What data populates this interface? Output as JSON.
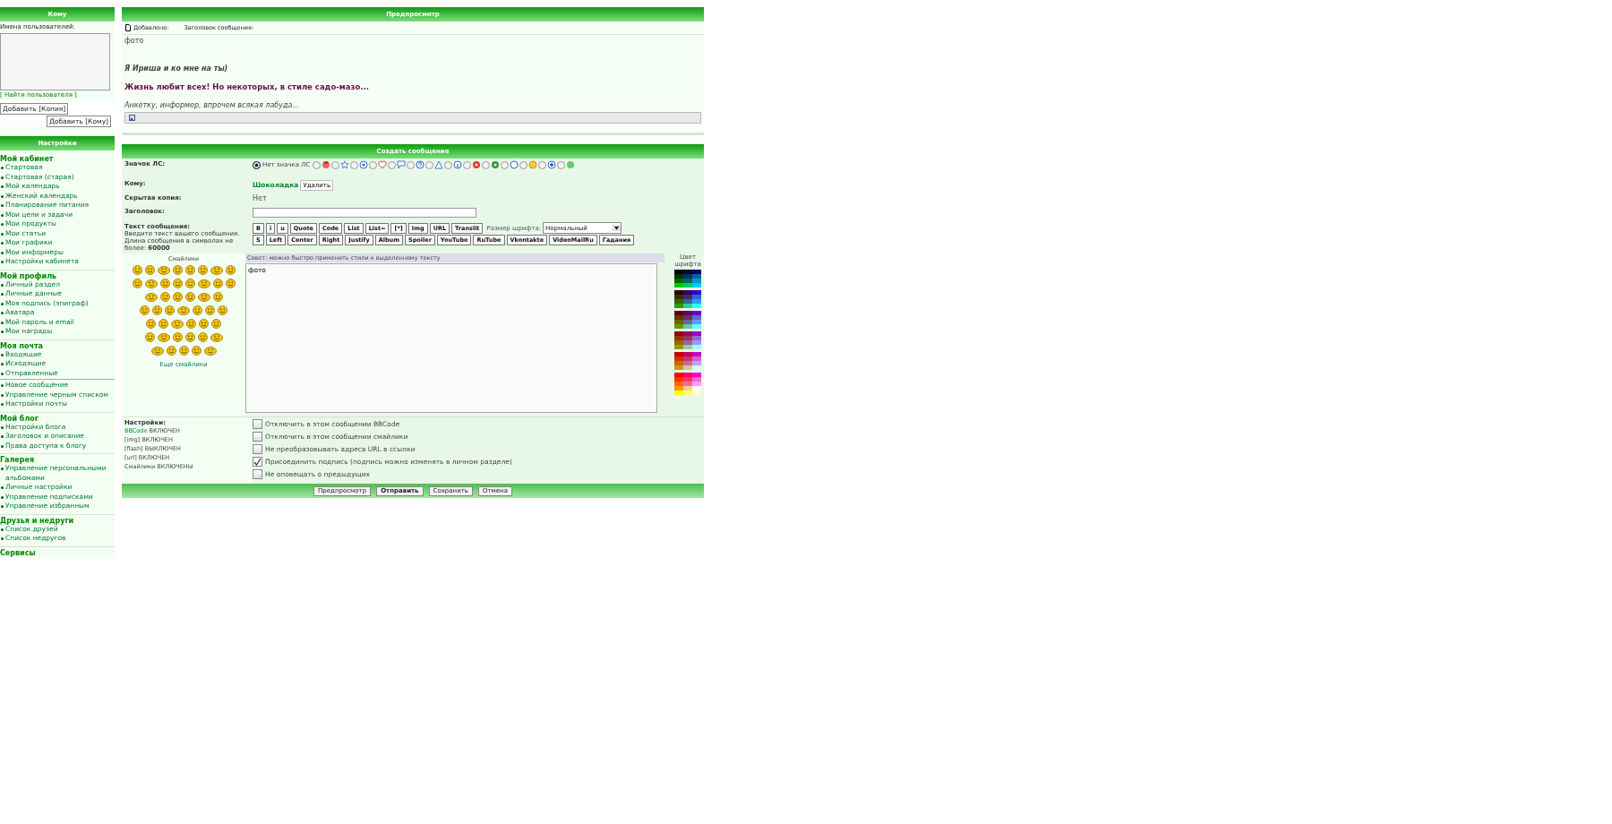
{
  "to_panel": {
    "title": "Кому",
    "label": "Имена пользователей:",
    "find_link": "[ Найти пользователя ]",
    "buttons": [
      "Добавить [Копия]",
      "Добавить [Кому]"
    ]
  },
  "settings_panel": {
    "title": "Настройки",
    "groups": [
      {
        "title": "Мой кабинет",
        "items": [
          "Стартовая",
          "Стартовая (старая)",
          "Мой календарь",
          "Женский календарь",
          "Планирование питания",
          "Мои цели и задачи",
          "Мои продукты",
          "Мои статьи",
          "Мои графики",
          "Мои информеры",
          "Настройки кабинета"
        ]
      },
      {
        "title": "Мой профиль",
        "items": [
          "Личный раздел",
          "Личные данные",
          "Моя подпись (эпиграф)",
          "Аватара",
          "Мой пароль и email",
          "Мои награды"
        ]
      },
      {
        "title": "Моя почта",
        "items": [
          "Входящие",
          "Исходящие",
          "Отправленные"
        ],
        "extra_items": [
          "Новое сообщение",
          "Управление черным списком",
          "Настройки почты"
        ]
      },
      {
        "title": "Мой блог",
        "items": [
          "Настройки блога",
          "Заголовок и описание",
          "Права доступа к блогу"
        ]
      },
      {
        "title": "Галерея",
        "items": [
          "Управление персональными альбомами",
          "Личные настройки",
          "Управление подписками",
          "Управление избранным"
        ]
      },
      {
        "title": "Друзья и недруги",
        "items": [
          "Список друзей",
          "Список недругов"
        ]
      },
      {
        "title": "Сервисы"
      }
    ]
  },
  "preview": {
    "title": "Предпросмотр",
    "added_label": "Добавлено:",
    "subject_label": "Заголовок сообщения:",
    "body": "фото",
    "signature": [
      {
        "kind": "italic",
        "text": "Я Ириша и ко мне на ты)"
      },
      {
        "kind": "accent",
        "text": "Жизнь любит всех! Но некоторых, в стиле садо-мазо..."
      },
      {
        "kind": "plain",
        "text": "Анкетку, информер, впрочем всякая лабуда..."
      }
    ]
  },
  "compose": {
    "title": "Создать сообщение",
    "icon_label": "Значок ЛС:",
    "icons": [
      {
        "label": "Нет значка ЛС",
        "selected": true
      },
      {
        "selected": false
      },
      {
        "selected": false
      },
      {
        "selected": false
      },
      {
        "selected": false
      },
      {
        "selected": false
      },
      {
        "selected": false
      },
      {
        "selected": false
      },
      {
        "selected": false
      },
      {
        "selected": false
      },
      {
        "selected": false
      },
      {
        "selected": false
      },
      {
        "selected": false
      },
      {
        "selected": false
      },
      {
        "selected": false
      }
    ],
    "to_label": "Кому:",
    "to_user": "Шоколадка",
    "remove_button": "Удалить",
    "bcc_label": "Скрытая копия:",
    "bcc_value": "Нет",
    "subject_label": "Заголовок:",
    "text_label": "Текст сообщения:",
    "text_hint": "Введите текст вашего сообщения. Длина сообщения в символах не более:",
    "text_limit": "60000",
    "toolbar_row1": [
      "B",
      "i",
      "u",
      "Quote",
      "Code",
      "List",
      "List=",
      "[*]",
      "Img",
      "URL",
      "Translit"
    ],
    "font_size_label": "Размер шрифта:",
    "font_size_value": "Нормальный",
    "toolbar_row2": [
      "S",
      "Left",
      "Center",
      "Right",
      "Justify",
      "Album",
      "Spoiler",
      "YouTube",
      "RuTube",
      "Vkontakte",
      "VideoMailRu",
      "Гадания"
    ],
    "tip": "Совет: можно быстро применить стили к выделенному тексту",
    "smileys_title": "Смайлики",
    "more_smileys": "Еще смайлики",
    "message": "фото",
    "color_label": "Цвет шрифта",
    "settings_title": "Настройки:",
    "settings": [
      {
        "link": "BBCode",
        "text": "ВКЛЮЧЕН"
      },
      {
        "text": "[img] ВКЛЮЧЕН"
      },
      {
        "text": "[flash] ВЫКЛЮЧЕН"
      },
      {
        "text": "[url] ВКЛЮЧЕН"
      },
      {
        "text": "Смайлики ВКЛЮЧЕНЫ"
      }
    ],
    "options": [
      {
        "label": "Отключить в этом сообщении BBCode",
        "checked": false
      },
      {
        "label": "Отключить в этом сообщении смайлики",
        "checked": false
      },
      {
        "label": "Не преобразовывать адреса URL в ссылки",
        "checked": false
      },
      {
        "label": "Присоединить подпись (подпись можно изменять в личном разделе)",
        "checked": true
      },
      {
        "label": "Не оповещать о предыдущих",
        "checked": false
      }
    ],
    "buttons": [
      {
        "label": "Предпросмотр",
        "primary": false
      },
      {
        "label": "Отправить",
        "primary": true
      },
      {
        "label": "Сохранить",
        "primary": false
      },
      {
        "label": "Отмена",
        "primary": false
      }
    ]
  }
}
